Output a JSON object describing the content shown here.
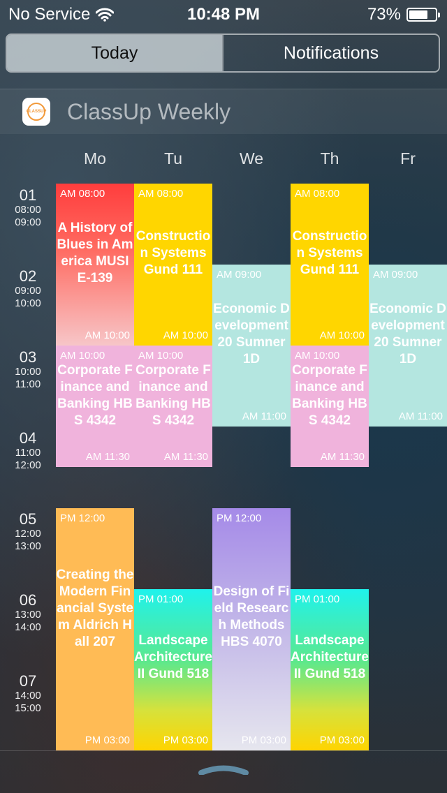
{
  "status": {
    "carrier": "No Service",
    "time": "10:48 PM",
    "battery_percent": "73%",
    "battery_level": 0.73
  },
  "tabs": {
    "today": "Today",
    "notifications": "Notifications"
  },
  "widget": {
    "title": "ClassUp Weekly",
    "icon_text": "CLASSUP"
  },
  "days": [
    "Mo",
    "Tu",
    "We",
    "Th",
    "Fr"
  ],
  "periods": [
    {
      "num": "01",
      "start": "08:00",
      "end": "09:00"
    },
    {
      "num": "02",
      "start": "09:00",
      "end": "10:00"
    },
    {
      "num": "03",
      "start": "10:00",
      "end": "11:00"
    },
    {
      "num": "04",
      "start": "11:00",
      "end": "12:00"
    },
    {
      "num": "05",
      "start": "12:00",
      "end": "13:00"
    },
    {
      "num": "06",
      "start": "13:00",
      "end": "14:00"
    },
    {
      "num": "07",
      "start": "14:00",
      "end": "15:00"
    }
  ],
  "events": [
    {
      "title": "A History of Blues in America MUSI E-139",
      "start": "AM 08:00",
      "end": "AM 10:00"
    },
    {
      "title": "Construction Systems Gund 111",
      "start": "AM 08:00",
      "end": "AM 10:00"
    },
    {
      "title": "Construction Systems Gund 111",
      "start": "AM 08:00",
      "end": "AM 10:00"
    },
    {
      "title": "Economic Development 20 Sumner 1D",
      "start": "AM 09:00",
      "end": "AM 11:00"
    },
    {
      "title": "Economic Development 20 Sumner 1D",
      "start": "AM 09:00",
      "end": "AM 11:00"
    },
    {
      "title": "Corporate Finance and Banking HBS 4342",
      "start": "AM 10:00",
      "end": "AM 11:30"
    },
    {
      "title": "Corporate Finance and Banking HBS 4342",
      "start": "AM 10:00",
      "end": "AM 11:30"
    },
    {
      "title": "Corporate Finance and Banking HBS 4342",
      "start": "AM 10:00",
      "end": "AM 11:30"
    },
    {
      "title": "Creating the Modern Financial System Aldrich Hall 207",
      "start": "PM 12:00",
      "end": "PM 03:00"
    },
    {
      "title": "Design of Field Research Methods HBS 4070",
      "start": "PM 12:00",
      "end": "PM 03:00"
    },
    {
      "title": "Landscape Architecture II Gund 518",
      "start": "PM 01:00",
      "end": "PM 03:00"
    },
    {
      "title": "Landscape Architecture II Gund 518",
      "start": "PM 01:00",
      "end": "PM 03:00"
    }
  ],
  "colors": {
    "history": "#ff4a45",
    "construction": "#ffd600",
    "economic": "#b4e6e0",
    "corporate": "#f0b3dc",
    "creating": "#ffbb55",
    "design": "#a88bea",
    "landscape": "#21f0e0"
  }
}
